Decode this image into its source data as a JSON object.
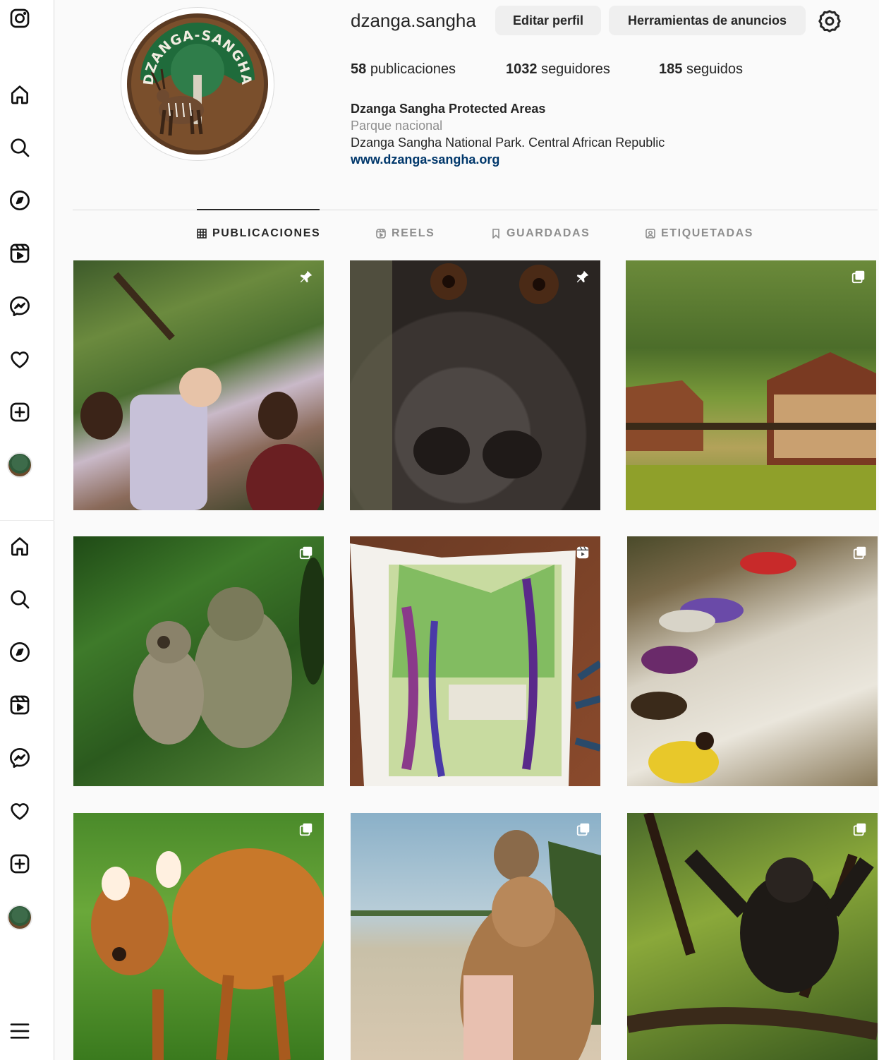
{
  "app": {
    "name": "Instagram"
  },
  "profile": {
    "username": "dzanga.sangha",
    "edit_button": "Editar perfil",
    "ads_button": "Herramientas de anuncios",
    "posts_count": "58",
    "posts_label": "publicaciones",
    "followers_count": "1032",
    "followers_label": "seguidores",
    "following_count": "185",
    "following_label": "seguidos",
    "display_name": "Dzanga Sangha Protected Areas",
    "category": "Parque nacional",
    "bio": "Dzanga Sangha National Park. Central African Republic",
    "website": "www.dzanga-sangha.org",
    "avatar_text": "DZANGA-SANGHA"
  },
  "sidebar": {
    "icons": [
      "instagram-logo-icon",
      "home-icon",
      "search-icon",
      "explore-icon",
      "reels-icon",
      "messenger-icon",
      "heart-icon",
      "create-icon",
      "profile-avatar",
      "home-icon",
      "search-icon",
      "explore-icon",
      "reels-icon",
      "messenger-icon",
      "heart-icon",
      "create-icon",
      "profile-avatar",
      "menu-icon"
    ]
  },
  "tabs": [
    {
      "label": "PUBLICACIONES",
      "icon": "grid-icon",
      "active": true
    },
    {
      "label": "REELS",
      "icon": "reels-icon",
      "active": false
    },
    {
      "label": "GUARDADAS",
      "icon": "bookmark-icon",
      "active": false
    },
    {
      "label": "ETIQUETADAS",
      "icon": "tagged-icon",
      "active": false
    }
  ],
  "posts": [
    {
      "subject": "people looking up in forest",
      "badge": "pin-icon"
    },
    {
      "subject": "gorilla face close-up",
      "badge": "pin-icon"
    },
    {
      "subject": "lodge by the river",
      "badge": "carousel-icon"
    },
    {
      "subject": "monkeys in trees",
      "badge": "carousel-icon"
    },
    {
      "subject": "sketchbook painting",
      "badge": "reel-icon"
    },
    {
      "subject": "women in river",
      "badge": "carousel-icon"
    },
    {
      "subject": "sitatunga antelope",
      "badge": "carousel-icon"
    },
    {
      "subject": "woman in canoe on river",
      "badge": "carousel-icon"
    },
    {
      "subject": "gorilla in tree",
      "badge": "carousel-icon"
    }
  ],
  "colors": {
    "link": "#00376b",
    "muted": "#8e8e8e",
    "button_bg": "#efefef"
  }
}
